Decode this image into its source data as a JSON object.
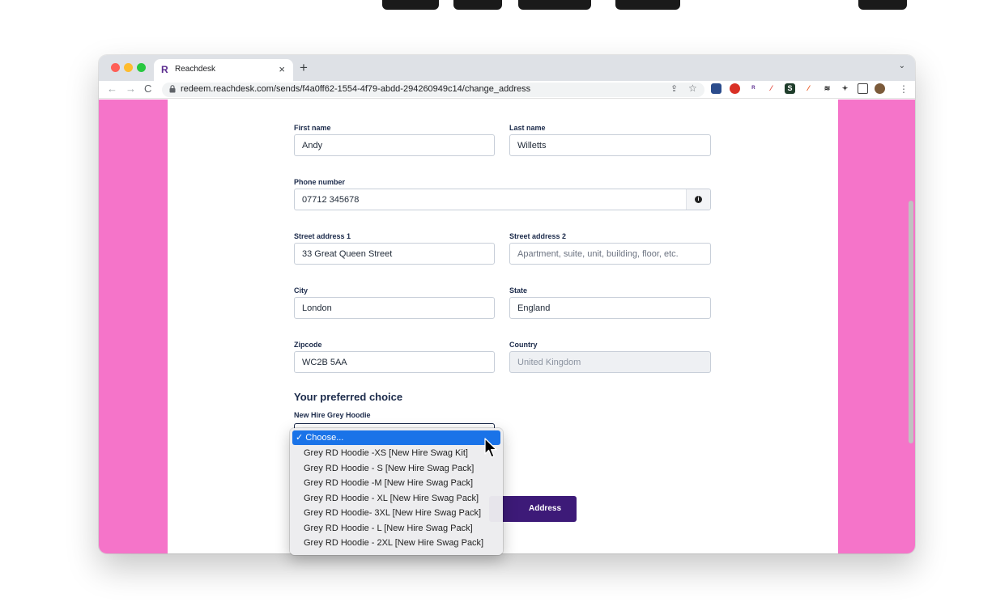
{
  "browser": {
    "tab_title": "Reachdesk",
    "tab_favicon": "R",
    "tab_close": "×",
    "new_tab": "+",
    "tab_menu": "⌄",
    "url": "redeem.reachdesk.com/sends/f4a0ff62-1554-4f79-abdd-294260949c14/change_address",
    "nav": {
      "back": "←",
      "forward": "→",
      "reload": "C"
    }
  },
  "form": {
    "first_name": {
      "label": "First name",
      "value": "Andy"
    },
    "last_name": {
      "label": "Last name",
      "value": "Willetts"
    },
    "phone": {
      "label": "Phone number",
      "value": "07712 345678",
      "info": "i"
    },
    "street1": {
      "label": "Street address 1",
      "value": "33 Great Queen Street"
    },
    "street2": {
      "label": "Street address 2",
      "placeholder": "Apartment, suite, unit, building, floor, etc."
    },
    "city": {
      "label": "City",
      "value": "London"
    },
    "state": {
      "label": "State",
      "value": "England"
    },
    "zipcode": {
      "label": "Zipcode",
      "value": "WC2B 5AA"
    },
    "country": {
      "label": "Country",
      "value": "United Kingdom"
    },
    "preferred_heading": "Your preferred choice",
    "select_label": "New Hire Grey Hoodie",
    "submit_partial": "Address"
  },
  "dropdown": {
    "selected": "✓ Choose...",
    "options": [
      "Grey RD Hoodie -XS [New Hire Swag Kit]",
      "Grey RD Hoodie - S [New Hire Swag Pack]",
      "Grey RD Hoodie -M [New Hire Swag Pack]",
      "Grey RD Hoodie - XL [New Hire Swag Pack]",
      "Grey RD Hoodie- 3XL [New Hire Swag Pack]",
      "Grey RD Hoodie - L [New Hire Swag Pack]",
      "Grey RD Hoodie - 2XL [New Hire Swag Pack]"
    ]
  },
  "colors": {
    "page_bg": "#f574c9",
    "brand": "#3d1a78",
    "selection": "#1a73e8"
  },
  "icons": [
    "lock-icon",
    "share-icon",
    "star-icon",
    "extension-icons",
    "puzzle-icon",
    "sidepanel-icon",
    "profile-icon",
    "menu-icon",
    "info-icon",
    "cursor-icon"
  ]
}
